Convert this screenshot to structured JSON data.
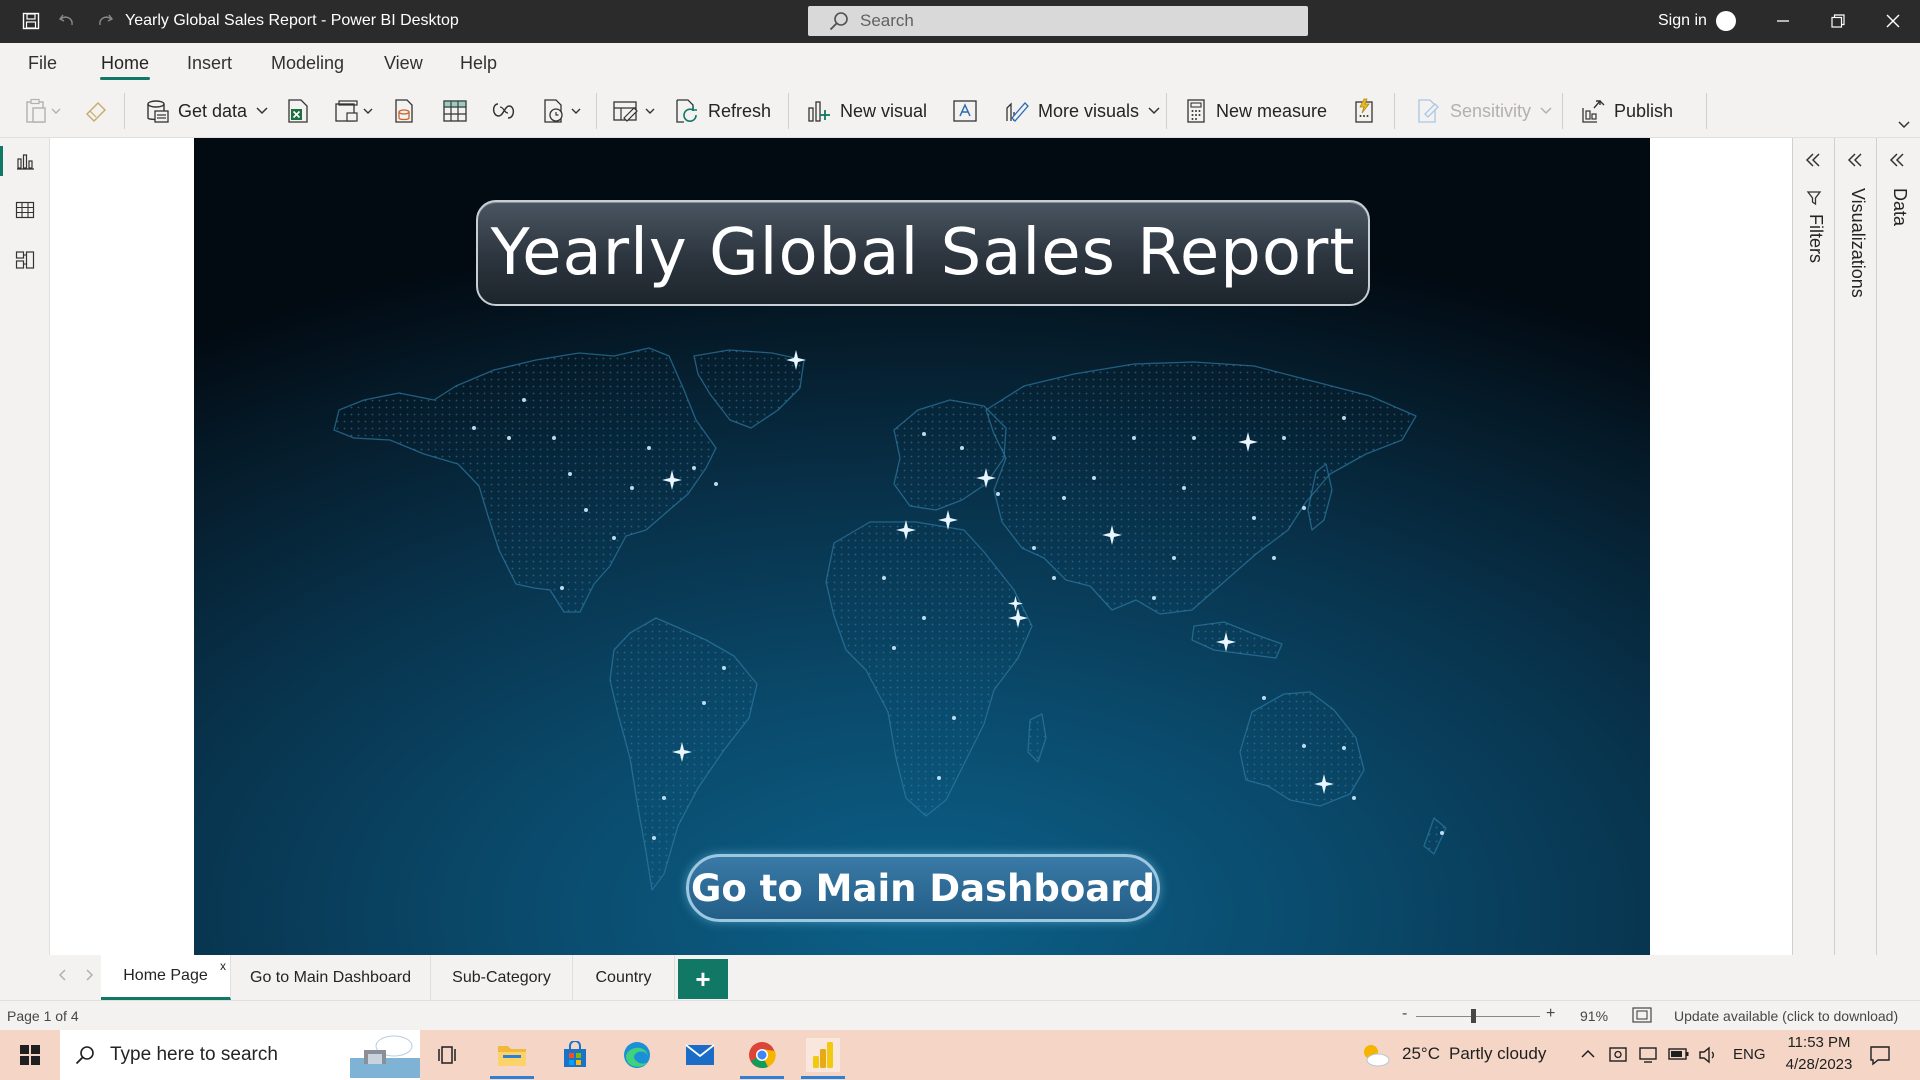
{
  "window": {
    "title": "Yearly Global Sales Report - Power BI Desktop",
    "search_placeholder": "Search",
    "sign_in": "Sign in"
  },
  "menu": {
    "items": [
      "File",
      "Home",
      "Insert",
      "Modeling",
      "View",
      "Help"
    ],
    "active": "Home"
  },
  "ribbon": {
    "get_data": "Get data",
    "refresh": "Refresh",
    "new_visual": "New visual",
    "more_visuals": "More visuals",
    "new_measure": "New measure",
    "sensitivity": "Sensitivity",
    "publish": "Publish"
  },
  "report": {
    "title": "Yearly Global Sales Report",
    "button_label": "Go to Main Dashboard"
  },
  "panes": {
    "filters": "Filters",
    "visualizations": "Visualizations",
    "data": "Data"
  },
  "page_tabs": {
    "tabs": [
      "Home Page",
      "Go to Main Dashboard",
      "Sub-Category",
      "Country"
    ],
    "active": "Home Page",
    "close_glyph": "x",
    "add_glyph": "+"
  },
  "status": {
    "page_info": "Page 1 of 4",
    "zoom_minus": "-",
    "zoom_plus": "+",
    "zoom": "91%",
    "update": "Update available (click to download)"
  },
  "taskbar": {
    "search_placeholder": "Type here to search",
    "weather_temp": "25°C",
    "weather_desc": "Partly cloudy",
    "language": "ENG",
    "time": "11:53 PM",
    "date": "4/28/2023"
  },
  "colors": {
    "accent": "#117865",
    "titlebar": "#2b2b2b",
    "report_bg": "#08324b",
    "button_fill": "#2a6a96",
    "taskbar_bg": "#f5d6c6"
  },
  "icons": [
    "save-icon",
    "undo-icon",
    "redo-icon",
    "search-icon",
    "minimize-icon",
    "restore-icon",
    "close-icon",
    "paste-icon",
    "format-painter-icon",
    "get-data-icon",
    "excel-icon",
    "onelake-icon",
    "sql-icon",
    "enter-data-icon",
    "dataverse-icon",
    "recent-sources-icon",
    "transform-data-icon",
    "refresh-icon",
    "new-visual-icon",
    "text-box-icon",
    "more-visuals-icon",
    "new-measure-icon",
    "quick-measure-icon",
    "sensitivity-icon",
    "publish-icon",
    "report-view-icon",
    "table-view-icon",
    "model-view-icon",
    "filter-icon",
    "windows-start-icon",
    "task-view-icon",
    "file-explorer-icon",
    "store-icon",
    "edge-icon",
    "mail-icon",
    "chrome-icon",
    "power-bi-icon",
    "weather-icon",
    "notification-icon"
  ]
}
